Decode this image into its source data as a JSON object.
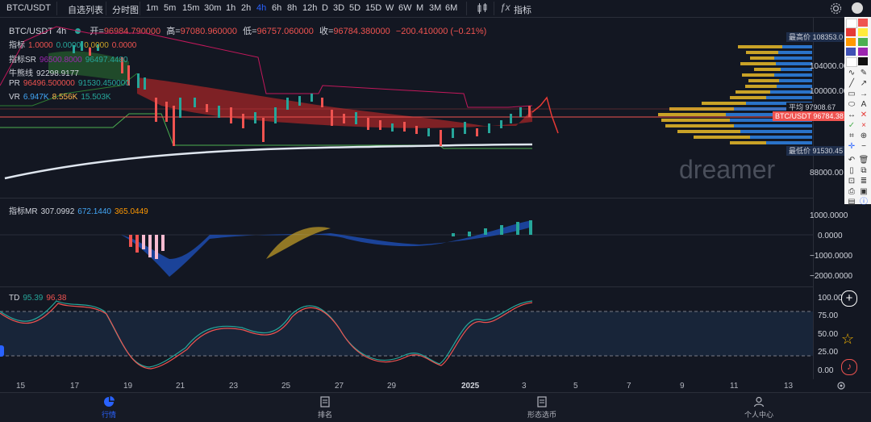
{
  "topbar": {
    "symbol": "BTC/USDT",
    "watchlist": "自选列表",
    "timeshare": "分时图",
    "timeframes": [
      "1m",
      "5m",
      "15m",
      "30m",
      "1h",
      "2h",
      "4h",
      "6h",
      "8h",
      "12h",
      "D",
      "3D",
      "5D",
      "15D",
      "W",
      "6W",
      "M",
      "3M",
      "6M"
    ],
    "active_tf": "4h",
    "indicator": "指标"
  },
  "header": {
    "pair": "BTC/USDT",
    "interval": "4h",
    "open_label": "开=",
    "open": "96984.790000",
    "high_label": "高=",
    "high": "97080.960000",
    "low_label": "低=",
    "low": "96757.060000",
    "close_label": "收=",
    "close": "96784.380000",
    "change": "−200.410000 (−0.21%)"
  },
  "legends": {
    "ind": {
      "label": "指标",
      "v1": "1.0000",
      "v2": "0.0000",
      "v3": "0.0000",
      "v4": "0.0000"
    },
    "sr": {
      "label": "指标SR",
      "v1": "96500.8000",
      "v2": "96497.4480"
    },
    "bull": {
      "label": "牛熊线",
      "v1": "92298.9177"
    },
    "pr": {
      "label": "PR",
      "v1": "96496.500000",
      "v2": "91530.450000"
    },
    "vr": {
      "label": "VR",
      "v1": "6.947K",
      "v2": "8.556K",
      "v3": "15.503K"
    },
    "mr": {
      "label": "指标MR",
      "v1": "307.0992",
      "v2": "672.1440",
      "v3": "365.0449"
    },
    "td": {
      "label": "TD",
      "v1": "95.39",
      "v2": "96.38"
    }
  },
  "price_axis": [
    "104000.00",
    "100000.00",
    "88000.00"
  ],
  "price_tags": {
    "high_label": "最高价",
    "high": "108353.0",
    "avg_label": "平均",
    "avg": "97908.67",
    "cur_label": "BTC/USDT",
    "cur": "96784.38",
    "low_label": "最低价",
    "low": "91530.45"
  },
  "mr_axis": [
    "1000.0000",
    "0.0000",
    "−1000.0000",
    "−2000.0000"
  ],
  "td_axis": [
    "100.00",
    "75.00",
    "50.00",
    "25.00",
    "0.00"
  ],
  "xaxis": [
    "15",
    "17",
    "19",
    "21",
    "23",
    "25",
    "27",
    "29",
    "2025",
    "3",
    "5",
    "7",
    "9",
    "11",
    "13"
  ],
  "watermark": "dreamer",
  "nav": [
    {
      "label": "行情",
      "icon": "chart-pie-icon"
    },
    {
      "label": "排名",
      "icon": "ranking-icon"
    },
    {
      "label": "形态选币",
      "icon": "pattern-icon"
    },
    {
      "label": "个人中心",
      "icon": "user-icon"
    }
  ],
  "colors": {
    "bg": "#131722",
    "up": "#26a69a",
    "down": "#ef5350",
    "accent": "#2962ff"
  }
}
